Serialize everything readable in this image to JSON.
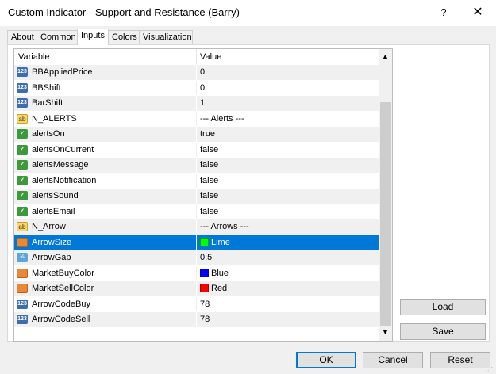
{
  "window": {
    "title": "Custom Indicator - Support and Resistance (Barry)",
    "help_glyph": "?",
    "close_glyph": "✕"
  },
  "tabs": [
    {
      "label": "About",
      "active": false
    },
    {
      "label": "Common",
      "active": false
    },
    {
      "label": "Inputs",
      "active": true
    },
    {
      "label": "Colors",
      "active": false
    },
    {
      "label": "Visualization",
      "active": false
    }
  ],
  "grid": {
    "header": {
      "variable": "Variable",
      "value": "Value"
    },
    "rows": [
      {
        "icon": "int-icon",
        "badge": "123",
        "name": "BBAppliedPrice",
        "value": "0"
      },
      {
        "icon": "int-icon",
        "badge": "123",
        "name": "BBShift",
        "value": "0"
      },
      {
        "icon": "int-icon",
        "badge": "123",
        "name": "BarShift",
        "value": "1"
      },
      {
        "icon": "string-icon",
        "badge": "ab",
        "name": "N_ALERTS",
        "value": "--- Alerts ---"
      },
      {
        "icon": "bool-icon",
        "badge": "✓",
        "name": "alertsOn",
        "value": "true"
      },
      {
        "icon": "bool-icon",
        "badge": "✓",
        "name": "alertsOnCurrent",
        "value": "false"
      },
      {
        "icon": "bool-icon",
        "badge": "✓",
        "name": "alertsMessage",
        "value": "false"
      },
      {
        "icon": "bool-icon",
        "badge": "✓",
        "name": "alertsNotification",
        "value": "false"
      },
      {
        "icon": "bool-icon",
        "badge": "✓",
        "name": "alertsSound",
        "value": "false"
      },
      {
        "icon": "bool-icon",
        "badge": "✓",
        "name": "alertsEmail",
        "value": "false"
      },
      {
        "icon": "string-icon",
        "badge": "ab",
        "name": "N_Arrow",
        "value": "--- Arrows ---"
      },
      {
        "icon": "color-icon",
        "badge": "",
        "name": "ArrowSize",
        "value": "Lime",
        "swatch": "#00ff00",
        "selected": true
      },
      {
        "icon": "double-icon",
        "badge": "½",
        "name": "ArrowGap",
        "value": "0.5"
      },
      {
        "icon": "color-icon",
        "badge": "",
        "name": "MarketBuyColor",
        "value": "Blue",
        "swatch": "#0000ff"
      },
      {
        "icon": "color-icon",
        "badge": "",
        "name": "MarketSellColor",
        "value": "Red",
        "swatch": "#ff0000"
      },
      {
        "icon": "int-icon",
        "badge": "123",
        "name": "ArrowCodeBuy",
        "value": "78"
      },
      {
        "icon": "int-icon",
        "badge": "123",
        "name": "ArrowCodeSell",
        "value": "78"
      }
    ]
  },
  "side_buttons": {
    "load": "Load",
    "save": "Save"
  },
  "footer": {
    "ok": "OK",
    "cancel": "Cancel",
    "reset": "Reset"
  },
  "colors": {
    "selection": "#0078d7",
    "default_button_border": "#0078d7"
  }
}
